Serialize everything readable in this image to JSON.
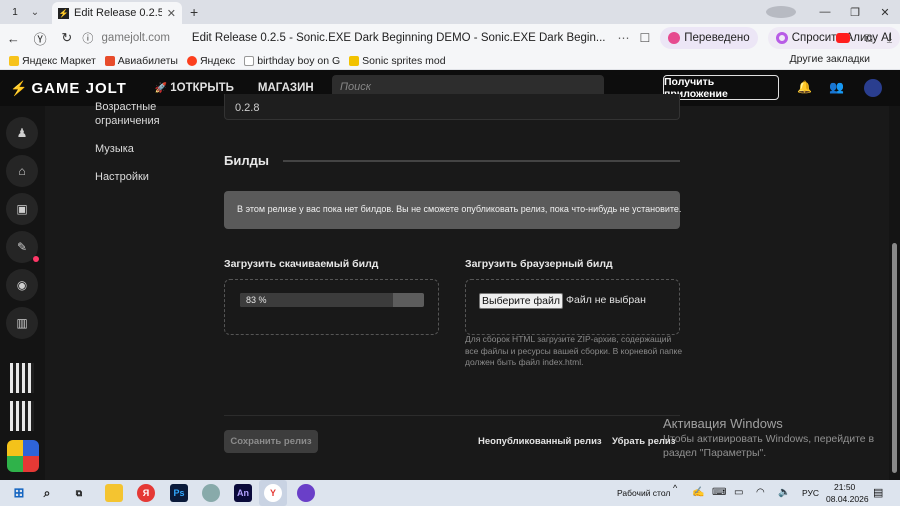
{
  "browser": {
    "tab_count": "1",
    "tab_title": "Edit Release 0.2.5 - Sonic",
    "domain": "gamejolt.com",
    "page_title": "Edit Release 0.2.5 - Sonic.EXE Dark Beginning DEMO - Sonic.EXE Dark Begin...",
    "translated_label": "Переведено",
    "alice_label": "Спросить Алису AI",
    "bookmarks": [
      "Яндекс Маркет",
      "Авиабилеты",
      "Яндекс",
      "birthday boy on G",
      "Sonic sprites mod"
    ],
    "other_bookmarks": "Другие закладки"
  },
  "header": {
    "logo": "GAME JOLT",
    "nav_discover": "1ОТКРЫТЬ",
    "nav_store": "МАГАЗИН",
    "more": "⋮",
    "search_placeholder": "Поиск",
    "get_app": "Получить приложение"
  },
  "side_menu": [
    "Возрастные ограничения",
    "Музыка",
    "Настройки"
  ],
  "release": {
    "version": "0.2.8",
    "builds_title": "Билды",
    "notice": "В этом релизе у вас пока нет билдов. Вы не сможете опубликовать релиз, пока что-нибудь не установите.",
    "upload_download_title": "Загрузить скачиваемый билд",
    "upload_progress_label": "83 %",
    "upload_progress": 0.83,
    "upload_browser_title": "Загрузить браузерный билд",
    "file_button": "Выберите файл",
    "file_none": "Файл не выбран",
    "html_hint": "Для сборок HTML загрузите ZIP-архив, содержащий все файлы и ресурсы вашей сборки. В корневой папке должен быть файл index.html.",
    "save_button": "Сохранить релиз",
    "unpublished": "Неопубликованный релиз",
    "remove": "Убрать релиз"
  },
  "watermark": {
    "title": "Активация Windows",
    "text": "Чтобы активировать Windows, перейдите в раздел \"Параметры\"."
  },
  "taskbar": {
    "desktop": "Рабочий стол",
    "lang": "РУС",
    "time": "21:50",
    "date": "08.04.2026"
  },
  "colors": {
    "page_bg": "#191919",
    "header_bg": "#0d0d0d",
    "notice_bg": "#5a5a5a",
    "badge": "#ff3868"
  }
}
